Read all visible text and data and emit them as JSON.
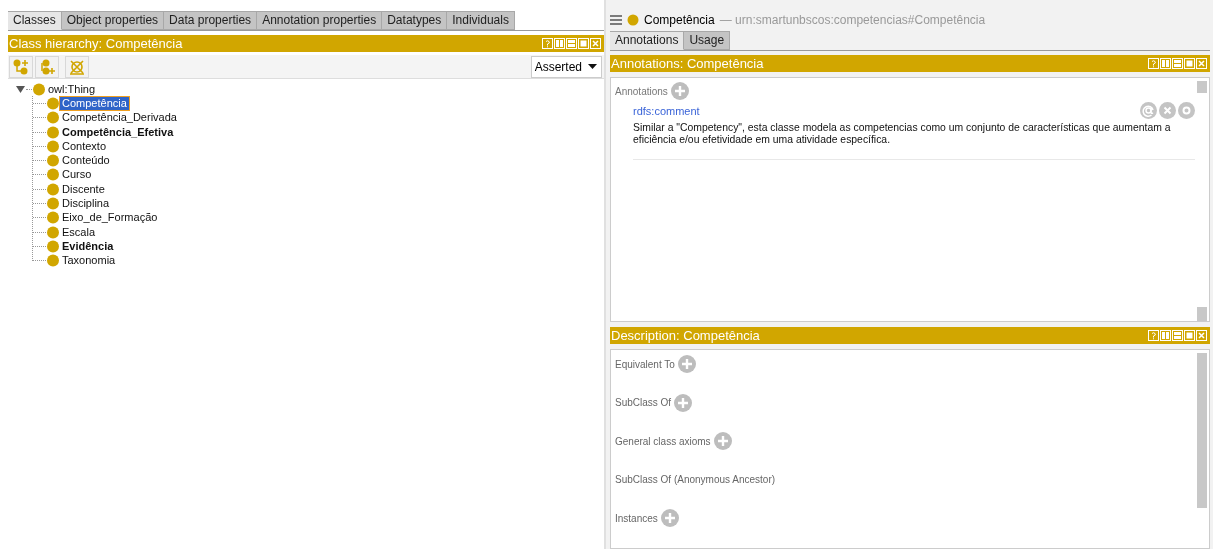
{
  "left_tabs": [
    {
      "label": "Classes",
      "selected": true
    },
    {
      "label": "Object properties",
      "selected": false
    },
    {
      "label": "Data properties",
      "selected": false
    },
    {
      "label": "Annotation properties",
      "selected": false
    },
    {
      "label": "Datatypes",
      "selected": false
    },
    {
      "label": "Individuals",
      "selected": false
    }
  ],
  "class_hierarchy": {
    "title": "Class hierarchy: Competência",
    "mode": "Asserted",
    "tree": {
      "label": "owl:Thing",
      "expanded": true,
      "children": [
        {
          "label": "Competência",
          "selected": true,
          "bold": false
        },
        {
          "label": "Competência_Derivada",
          "selected": false,
          "bold": false
        },
        {
          "label": "Competência_Efetiva",
          "selected": false,
          "bold": true
        },
        {
          "label": "Contexto",
          "selected": false,
          "bold": false
        },
        {
          "label": "Conteúdo",
          "selected": false,
          "bold": false
        },
        {
          "label": "Curso",
          "selected": false,
          "bold": false
        },
        {
          "label": "Discente",
          "selected": false,
          "bold": false
        },
        {
          "label": "Disciplina",
          "selected": false,
          "bold": false
        },
        {
          "label": "Eixo_de_Formação",
          "selected": false,
          "bold": false
        },
        {
          "label": "Escala",
          "selected": false,
          "bold": false
        },
        {
          "label": "Evidência",
          "selected": false,
          "bold": true
        },
        {
          "label": "Taxonomia",
          "selected": false,
          "bold": false
        }
      ]
    }
  },
  "entity": {
    "name": "Competência",
    "iri": "— urn:smartunbscos:competencias#Competência"
  },
  "right_tabs": [
    {
      "label": "Annotations",
      "selected": true
    },
    {
      "label": "Usage",
      "selected": false
    }
  ],
  "annotations_view": {
    "title": "Annotations: Competência",
    "section_label": "Annotations",
    "items": [
      {
        "property": "rdfs:comment",
        "value": "Similar a \"Competency\", esta classe modela as competencias como um conjunto de características que aumentam a eficiência e/ou efetividade em uma atividade específica."
      }
    ]
  },
  "description_view": {
    "title": "Description: Competência",
    "sections": [
      {
        "label": "Equivalent To",
        "addable": true
      },
      {
        "label": "SubClass Of",
        "addable": true
      },
      {
        "label": "General class axioms",
        "addable": true
      },
      {
        "label": "SubClass Of (Anonymous Ancestor)",
        "addable": false
      },
      {
        "label": "Instances",
        "addable": true
      }
    ]
  }
}
